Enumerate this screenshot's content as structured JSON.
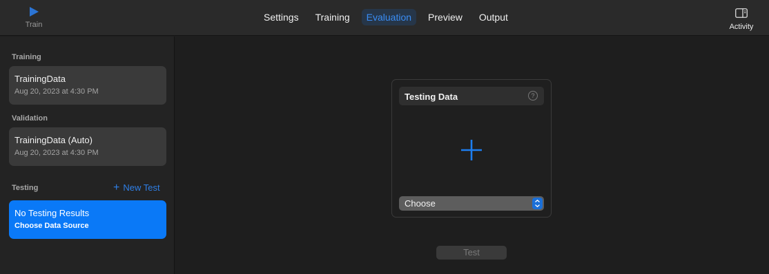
{
  "toolbar": {
    "train_label": "Train",
    "tabs": [
      "Settings",
      "Training",
      "Evaluation",
      "Preview",
      "Output"
    ],
    "active_tab": "Evaluation",
    "activity_label": "Activity"
  },
  "sidebar": {
    "training": {
      "title": "Training",
      "item": {
        "name": "TrainingData",
        "date": "Aug 20, 2023 at 4:30 PM"
      }
    },
    "validation": {
      "title": "Validation",
      "item": {
        "name": "TrainingData (Auto)",
        "date": "Aug 20, 2023 at 4:30 PM"
      }
    },
    "testing": {
      "title": "Testing",
      "new_test_label": "New Test",
      "item": {
        "name": "No Testing Results",
        "subtitle": "Choose Data Source"
      }
    }
  },
  "main": {
    "drop_panel": {
      "title": "Testing Data",
      "help_icon": "?",
      "add_icon": "plus-icon",
      "select_value": "Choose"
    },
    "test_button_label": "Test"
  },
  "colors": {
    "accent": "#0a79f7",
    "link": "#2f7fe6",
    "background": "#1e1e1e"
  }
}
